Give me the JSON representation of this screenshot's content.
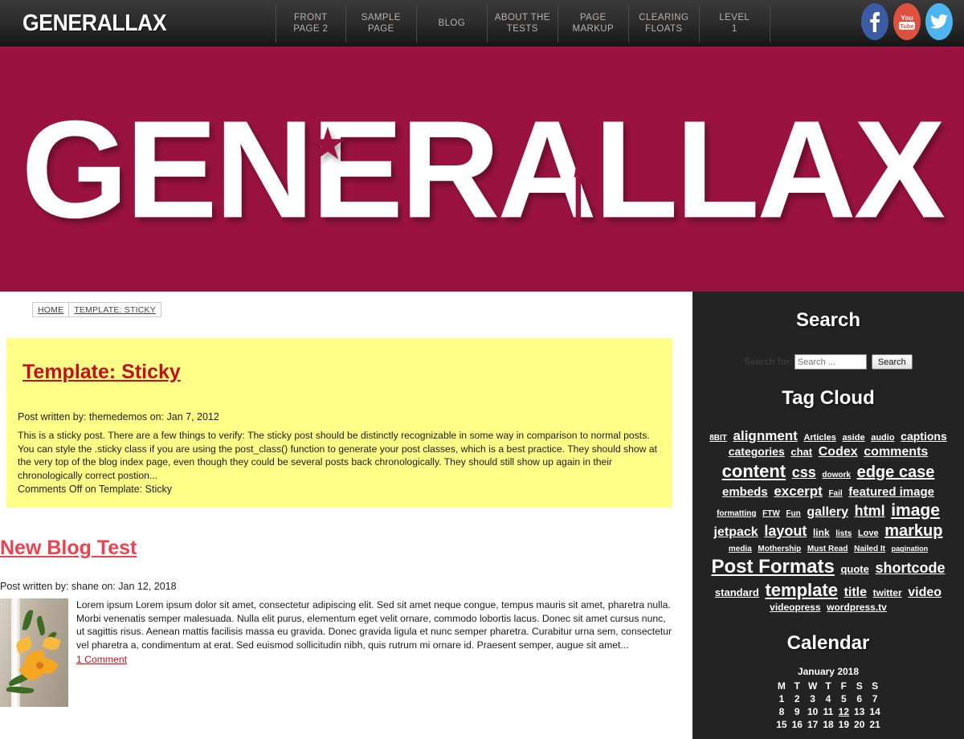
{
  "site": {
    "brand": "GENERALLAX",
    "hero_title": "GENERALLAX",
    "crimson": "#9a1340",
    "sidebar_bg": "#232323",
    "sticky_bg": "#ffff88",
    "link_red": "#c2101b"
  },
  "nav": {
    "items": [
      {
        "line1": "FRONT",
        "line2": "PAGE 2"
      },
      {
        "line1": "SAMPLE",
        "line2": "PAGE"
      },
      {
        "line1": "BLOG",
        "line2": ""
      },
      {
        "line1": "ABOUT THE",
        "line2": "TESTS"
      },
      {
        "line1": "PAGE",
        "line2": "MARKUP"
      },
      {
        "line1": "CLEARING",
        "line2": "FLOATS"
      },
      {
        "line1": "LEVEL",
        "line2": "1"
      }
    ],
    "social": [
      {
        "name": "facebook-icon",
        "label": "Facebook",
        "color": "#3b5ba5"
      },
      {
        "name": "youtube-icon",
        "label": "YouTube",
        "color": "#e0503f"
      },
      {
        "name": "twitter-icon",
        "label": "Twitter",
        "color": "#4cb5f0"
      }
    ]
  },
  "breadcrumb": {
    "items": [
      "HOME",
      "TEMPLATE: STICKY"
    ]
  },
  "sticky_post": {
    "title": "Template: Sticky",
    "meta": "Post written by: themedemos on: Jan 7, 2012",
    "excerpt": "This is a sticky post. There are a few things to verify: The sticky post should be distinctly recognizable in some way in comparison to normal posts. You can style the .sticky class if you are using the post_class() function to generate your post classes, which is a best practice. They should show at the very top of the blog index page, even though they could be several posts back chronologically. They should still show up again in their chronologically correct postion...",
    "comments": "Comments Off on Template: Sticky"
  },
  "blog_post": {
    "title": "New Blog Test",
    "meta": "Post written by: shane on: Jan 12, 2018",
    "body": "Lorem ipsum Lorem ipsum dolor sit amet, consectetur adipiscing elit. Sed sit amet neque congue, tempus mauris sit amet, pharetra nulla. Morbi venenatis semper malesuada. Nulla elit purus, elementum eget velit ornare, commodo lobortis lacus. Donec sit amet cursus nunc, ut sagittis risus. Aenean mattis facilisis massa eu gravida. Donec gravida ligula et nunc semper pharetra. Curabitur urna sem, consectetur vel pharetra a, condimentum at erat. Sed euismod sollicitudin nibh, quis rutrum mi ornare id. Praesent semper, augue sit amet...",
    "comment_link": "1 Comment",
    "thumbnail_alt": "orange-lily-flowers-photo"
  },
  "sidebar": {
    "search": {
      "title": "Search",
      "label": "Search for:",
      "placeholder": "Search ...",
      "value": "",
      "button": "Search"
    },
    "tagcloud": {
      "title": "Tag Cloud",
      "tags": [
        {
          "label": "8BIT",
          "size": 10
        },
        {
          "label": "alignment",
          "size": 17
        },
        {
          "label": "Articles",
          "size": 11
        },
        {
          "label": "aside",
          "size": 11
        },
        {
          "label": "audio",
          "size": 11
        },
        {
          "label": "captions",
          "size": 14
        },
        {
          "label": "categories",
          "size": 14
        },
        {
          "label": "chat",
          "size": 13
        },
        {
          "label": "Codex",
          "size": 16
        },
        {
          "label": "comments",
          "size": 16
        },
        {
          "label": "content",
          "size": 22
        },
        {
          "label": "css",
          "size": 18
        },
        {
          "label": "dowork",
          "size": 10
        },
        {
          "label": "edge case",
          "size": 20
        },
        {
          "label": "embeds",
          "size": 15
        },
        {
          "label": "excerpt",
          "size": 17
        },
        {
          "label": "Fail",
          "size": 10
        },
        {
          "label": "featured image",
          "size": 15
        },
        {
          "label": "formatting",
          "size": 10
        },
        {
          "label": "FTW",
          "size": 10
        },
        {
          "label": "Fun",
          "size": 10
        },
        {
          "label": "gallery",
          "size": 16
        },
        {
          "label": "html",
          "size": 18
        },
        {
          "label": "image",
          "size": 21
        },
        {
          "label": "jetpack",
          "size": 16
        },
        {
          "label": "layout",
          "size": 18
        },
        {
          "label": "link",
          "size": 12
        },
        {
          "label": "lists",
          "size": 10
        },
        {
          "label": "Love",
          "size": 11
        },
        {
          "label": "markup",
          "size": 20
        },
        {
          "label": "media",
          "size": 10
        },
        {
          "label": "Mothership",
          "size": 10
        },
        {
          "label": "Must Read",
          "size": 10
        },
        {
          "label": "Nailed It",
          "size": 10
        },
        {
          "label": "pagination",
          "size": 9
        },
        {
          "label": "Post Formats",
          "size": 24
        },
        {
          "label": "quote",
          "size": 13
        },
        {
          "label": "shortcode",
          "size": 18
        },
        {
          "label": "standard",
          "size": 13
        },
        {
          "label": "template",
          "size": 22
        },
        {
          "label": "title",
          "size": 16
        },
        {
          "label": "twitter",
          "size": 12
        },
        {
          "label": "video",
          "size": 16
        },
        {
          "label": "videopress",
          "size": 12
        },
        {
          "label": "wordpress.tv",
          "size": 12
        }
      ]
    },
    "calendar": {
      "title": "Calendar",
      "caption": "January 2018",
      "weekdays": [
        "M",
        "T",
        "W",
        "T",
        "F",
        "S",
        "S"
      ],
      "weeks": [
        [
          "1",
          "2",
          "3",
          "4",
          "5",
          "6",
          "7"
        ],
        [
          "8",
          "9",
          "10",
          "11",
          "12",
          "13",
          "14"
        ],
        [
          "15",
          "16",
          "17",
          "18",
          "19",
          "20",
          "21"
        ]
      ],
      "linked_day": "12"
    }
  }
}
